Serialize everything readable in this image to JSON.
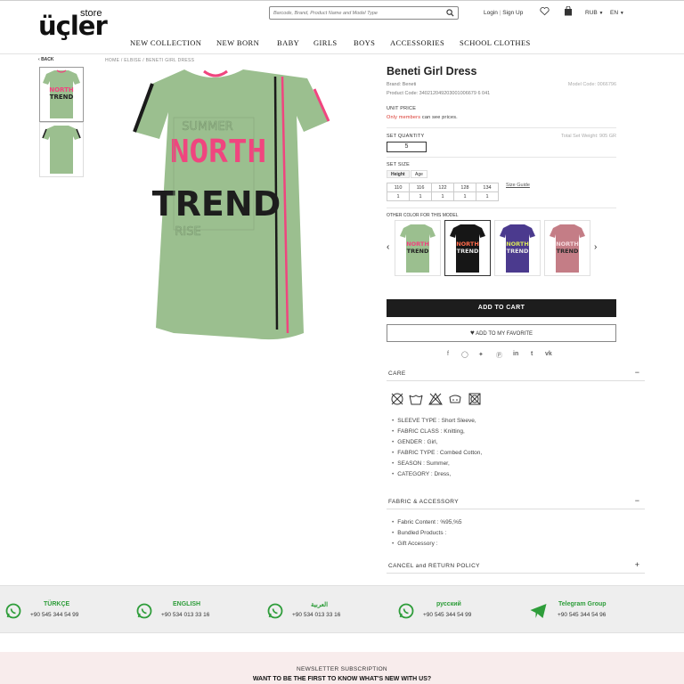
{
  "header": {
    "logo_main": "üçler",
    "logo_sub": "store",
    "search_placeholder": "Barcode, Brand, Product Name and Model Type",
    "login": "Login",
    "signup": "Sign Up",
    "currency": "RUB",
    "language": "EN",
    "icons": [
      "search-icon",
      "heart-icon",
      "bag-icon",
      "chevron-down-icon"
    ]
  },
  "nav": [
    "NEW COLLECTION",
    "NEW BORN",
    "BABY",
    "GIRLS",
    "BOYS",
    "ACCESSORIES",
    "SCHOOL CLOTHES"
  ],
  "breadcrumb": {
    "back": "BACK",
    "path": "HOME / ELBISE / BENETI GIRL DRESS"
  },
  "product": {
    "title": "Beneti Girl Dress",
    "brand": "Brand: Beneti",
    "model_code": "Model Code: 0066796",
    "product_code": "Product Code: 340212049203001006679 6 041",
    "unit_price_label": "UNIT PRICE",
    "members_prefix": "Only members",
    "members_suffix": " can see prices.",
    "set_quantity_label": "SET QUANTITY",
    "set_quantity_value": "5",
    "total_set_weight": "Total Set Weight: 905 GR",
    "set_size_label": "SET SIZE",
    "size_tabs": [
      "Height",
      "Age"
    ],
    "sizes": [
      "110",
      "116",
      "122",
      "128",
      "134"
    ],
    "size_counts": [
      "1",
      "1",
      "1",
      "1",
      "1"
    ],
    "size_guide": "Size Guide",
    "other_colors_label": "OTHER COLOR FOR THIS MODEL",
    "print_words": [
      "SUMMER",
      "NORTH",
      "TREND",
      "RISE"
    ],
    "colors": {
      "main_dress": "#9bbf8f",
      "swatches": [
        "#9bbf8f",
        "#161616",
        "#4b3a8e",
        "#c47d86"
      ],
      "accent_pink": "#f0457f"
    },
    "add_to_cart": "ADD TO CART",
    "add_to_favorite": "ADD TO MY FAVORITE",
    "social_icons": [
      "facebook-icon",
      "instagram-icon",
      "twitter-icon",
      "pinterest-icon",
      "linkedin-icon",
      "tumblr-icon",
      "vk-icon"
    ]
  },
  "care": {
    "title": "CARE",
    "toggle": "−",
    "care_icons": [
      "no-bleach-icon",
      "wash-30-icon",
      "do-not-bleach-icon",
      "tumble-dry-icon",
      "do-not-tumble-dry-icon"
    ],
    "items": [
      "SLEEVE TYPE : Short Sleeve,",
      "FABRIC CLASS : Knitting,",
      "GENDER : Girl,",
      "FABRIC TYPE : Combed Cotton,",
      "SEASON : Summer,",
      "CATEGORY : Dress,"
    ]
  },
  "fabric": {
    "title": "FABRIC & ACCESSORY",
    "toggle": "−",
    "items": [
      "Fabric Content : %95,%5",
      "Bundled Products :",
      "Gift Accessory :"
    ]
  },
  "cancel": {
    "title": "CANCEL and RETURN POLICY",
    "toggle": "+"
  },
  "contacts": [
    {
      "name": "TÜRKÇE",
      "phone": "+90 545 344 54 99",
      "icon": "whatsapp-icon"
    },
    {
      "name": "ENGLISH",
      "phone": "+90 534 013 33 16",
      "icon": "whatsapp-icon"
    },
    {
      "name": "العربية",
      "phone": "+90 534 013 33 16",
      "icon": "whatsapp-icon"
    },
    {
      "name": "русский",
      "phone": "+90 545 344 54 99",
      "icon": "whatsapp-icon"
    },
    {
      "name": "Telegram Group",
      "phone": "+90 545 344 54 96",
      "icon": "telegram-icon"
    }
  ],
  "newsletter": {
    "title": "NEWSLETTER SUBSCRIPTION",
    "tagline": "WANT TO BE THE FIRST TO KNOW WHAT'S NEW WITH US?"
  }
}
